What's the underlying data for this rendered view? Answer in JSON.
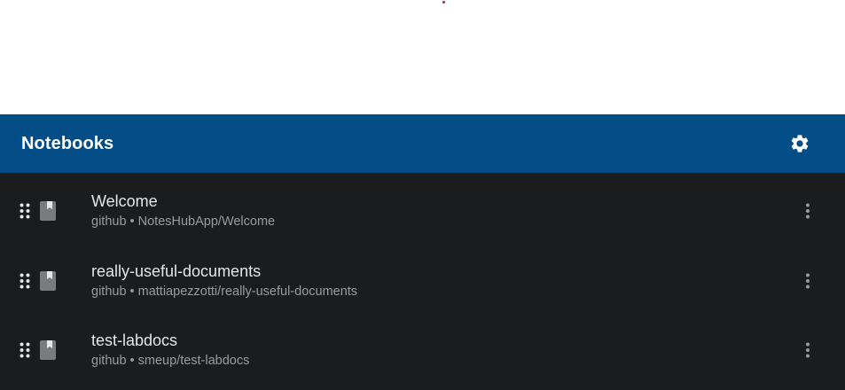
{
  "header": {
    "title": "Notebooks",
    "settings_icon": "gear-icon"
  },
  "notebooks": [
    {
      "title": "Welcome",
      "subtitle": "github • NotesHubApp/Welcome"
    },
    {
      "title": "really-useful-documents",
      "subtitle": "github • mattiapezzotti/really-useful-documents"
    },
    {
      "title": "test-labdocs",
      "subtitle": "github • smeup/test-labdocs"
    }
  ],
  "icons": {
    "drag": "drag-handle-icon",
    "notebook": "book-icon",
    "more": "more-vert-icon"
  },
  "colors": {
    "appbar": "#024d85",
    "list_background": "#1b1c1e",
    "title_text": "#e6e6e6",
    "subtitle_text": "#9a9b9d"
  }
}
